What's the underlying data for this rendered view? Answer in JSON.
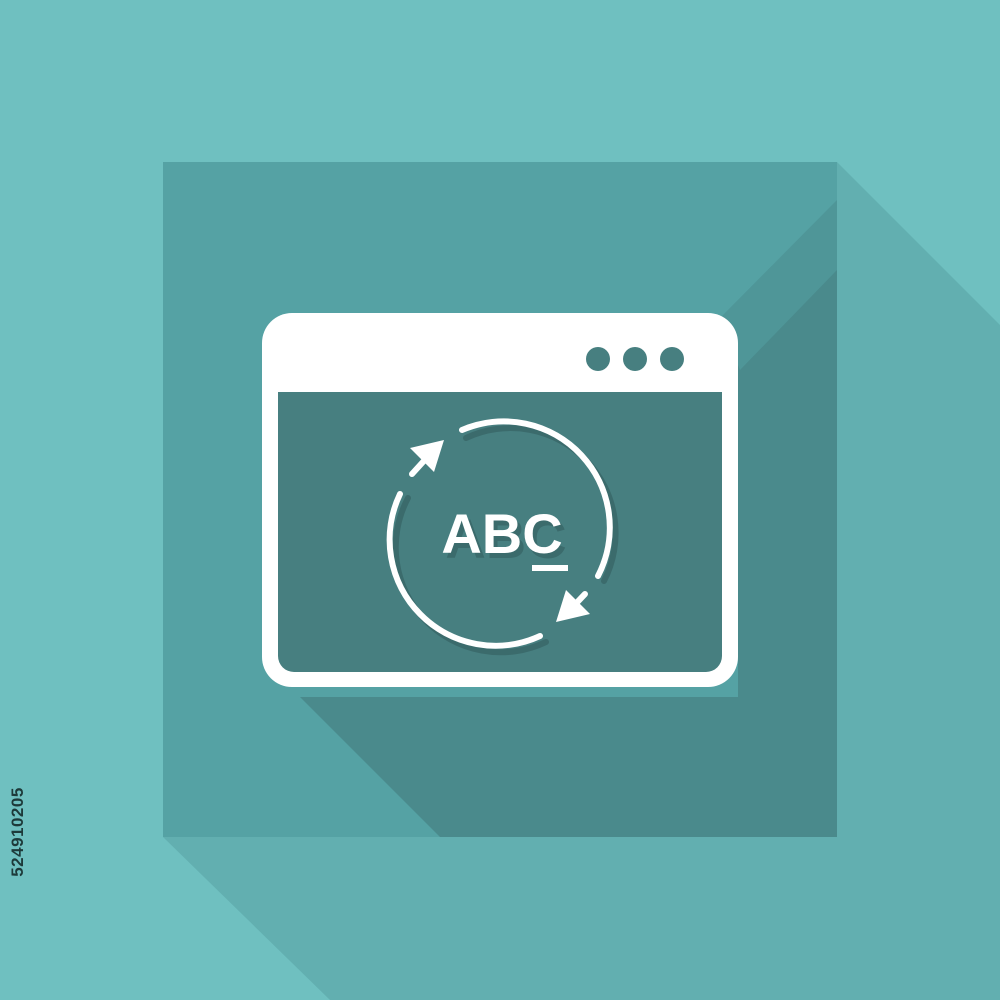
{
  "icon": {
    "text": "ABC",
    "semantic": "text-refresh-window-icon",
    "window_controls": 3
  },
  "stock_id": "524910205",
  "colors": {
    "background": "#6fc0c0",
    "tile": "#55a2a4",
    "long_shadow": "#4a8a8c",
    "window_body": "#477f80",
    "window_frame": "#ffffff"
  }
}
